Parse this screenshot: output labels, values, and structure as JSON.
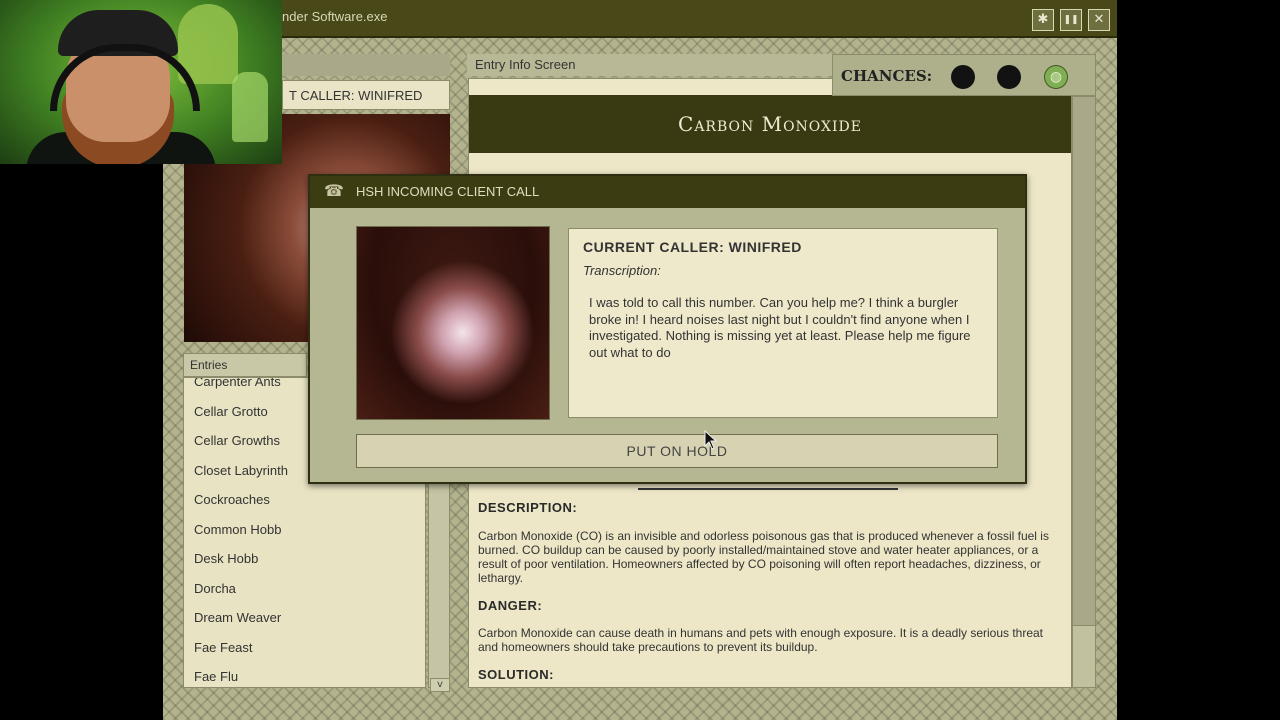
{
  "window": {
    "title": "nder Software.exe",
    "buttons": {
      "settings": "✱",
      "pause": "❚❚",
      "close": "✕"
    }
  },
  "left_panel": {
    "caller_tab": "T CALLER: WINIFRED",
    "entries_header": "Entries",
    "entries": [
      "Carpenter Ants",
      "Cellar Grotto",
      "Cellar Growths",
      "Closet Labyrinth",
      "Cockroaches",
      "Common Hobb",
      "Desk Hobb",
      "Dorcha",
      "Dream Weaver",
      "Fae Feast",
      "Fae Flu"
    ],
    "scroll_down": "v"
  },
  "info_screen": {
    "header": "Entry Info Screen",
    "entity_name": "Carbon Monoxide",
    "description_title": "DESCRIPTION:",
    "description": "Carbon Monoxide (CO) is an invisible and odorless poisonous gas that is produced whenever a fossil fuel is burned. CO buildup can be caused by poorly installed/maintained stove and water heater appliances, or a result of poor ventilation. Homeowners affected by CO poisoning will often report headaches, dizziness, or lethargy.",
    "danger_title": "DANGER:",
    "danger": "Carbon Monoxide can cause death in humans and pets with enough exposure. It is a deadly serious threat and homeowners should take precautions to prevent its buildup.",
    "solution_title": "SOLUTION:"
  },
  "chances": {
    "label": "CHANCES:",
    "remaining": 2,
    "total": 3
  },
  "modal": {
    "title": "HSH INCOMING CLIENT CALL",
    "caller": "CURRENT CALLER: WINIFRED",
    "transcription_label": "Transcription:",
    "transcription": "I was told to call this number. Can you help me? I think a burgler broke in! I heard noises last night but I couldn't find anyone when I investigated. Nothing is missing yet at least. Please help me figure out what to do",
    "hold_button": "PUT ON HOLD"
  },
  "colors": {
    "dark_olive": "#3a3a12",
    "parchment": "#ede7c7",
    "frame": "#b3b38e"
  }
}
